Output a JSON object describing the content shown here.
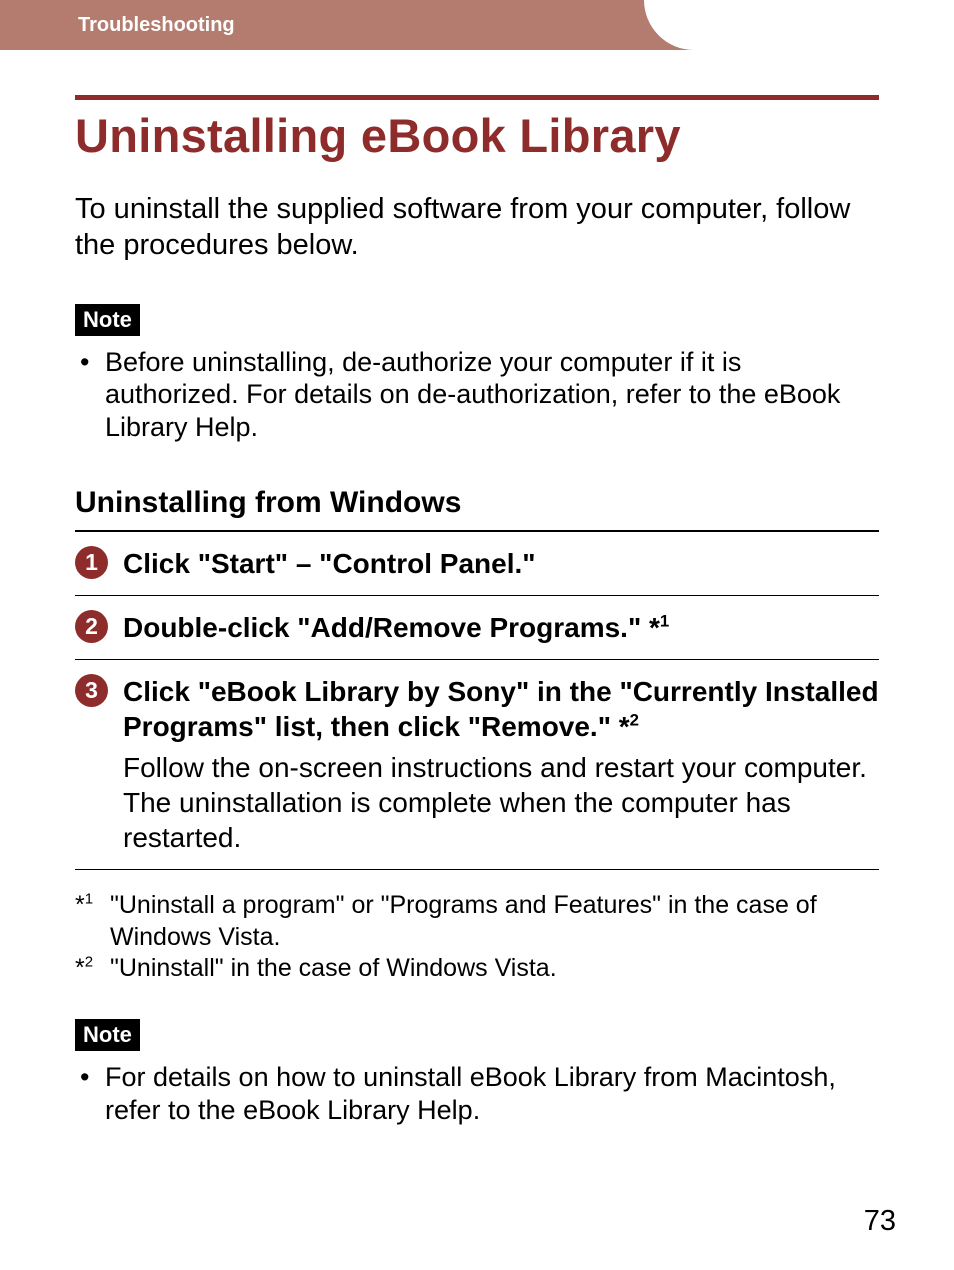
{
  "header": {
    "breadcrumb": "Troubleshooting"
  },
  "title": "Uninstalling eBook Library",
  "intro": "To uninstall the supplied software from your computer, follow the procedures below.",
  "note_label": "Note",
  "note1": "Before uninstalling, de-authorize your computer if it is authorized. For details on de-authorization, refer to the eBook Library Help.",
  "subheading": "Uninstalling from Windows",
  "steps": [
    {
      "num": "1",
      "head_a": "Click \"Start\" – \"Control Panel.\"",
      "head_b": "",
      "sup": "",
      "body": ""
    },
    {
      "num": "2",
      "head_a": "Double-click \"Add/Remove Programs.\" *",
      "head_b": "",
      "sup": "1",
      "body": ""
    },
    {
      "num": "3",
      "head_a": "Click \"eBook Library by Sony\" in the \"Currently Installed Programs\" list, then click \"Remove.\" *",
      "head_b": "",
      "sup": "2",
      "body": "Follow the on-screen instructions and restart your computer. The uninstallation is complete when the computer has restarted."
    }
  ],
  "footnotes": [
    {
      "marker_a": "*",
      "marker_sup": "1",
      "text": "\"Uninstall a program\" or \"Programs and Features\" in the case of Windows Vista."
    },
    {
      "marker_a": "*",
      "marker_sup": "2",
      "text": "\"Uninstall\" in the case of Windows Vista."
    }
  ],
  "note2": "For details on how to uninstall eBook Library from Macintosh, refer to the eBook Library Help.",
  "page_number": "73"
}
